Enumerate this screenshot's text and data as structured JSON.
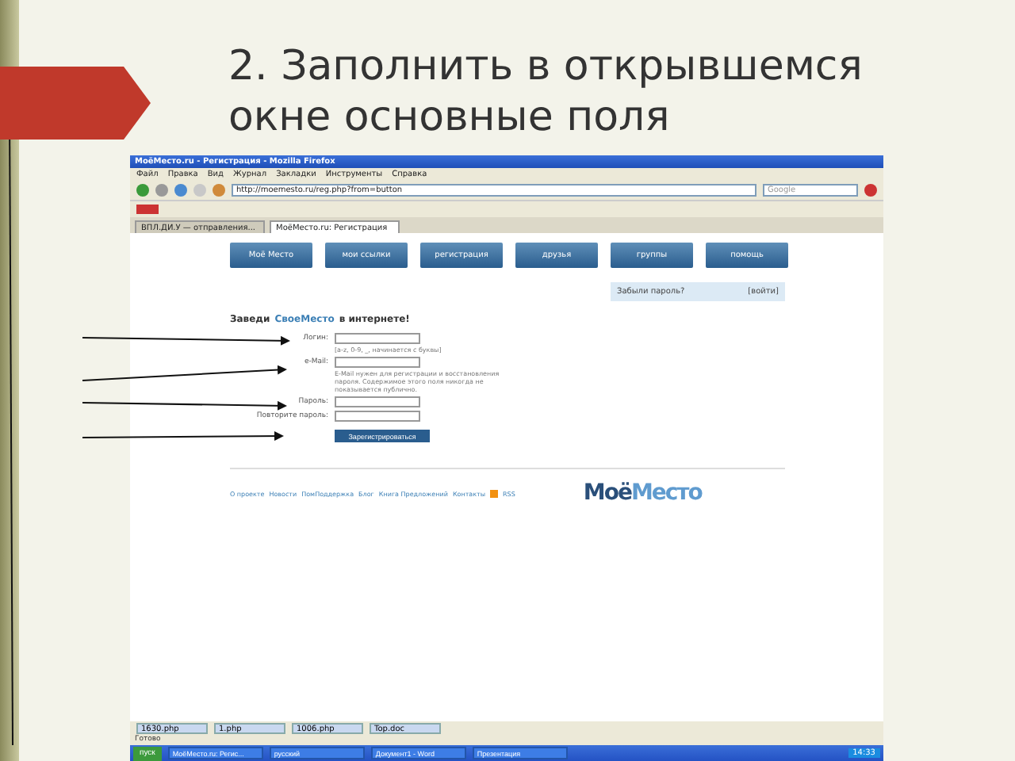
{
  "slide": {
    "title": "2. Заполнить в открывшемся окне основные поля"
  },
  "browser": {
    "title": "МоёМесто.ru - Регистрация - Mozilla Firefox",
    "menu": [
      "Файл",
      "Правка",
      "Вид",
      "Журнал",
      "Закладки",
      "Инструменты",
      "Справка"
    ],
    "address": "http://moemesto.ru/reg.php?from=button",
    "search_placeholder": "Google",
    "tabs": [
      {
        "label": "ВПЛ.ДИ.У — отправления...",
        "selected": false
      },
      {
        "label": "МоёМесто.ru: Регистрация",
        "selected": true
      }
    ]
  },
  "site": {
    "nav": [
      "Моё Место",
      "мои ссылки",
      "регистрация",
      "друзья",
      "группы",
      "помощь"
    ],
    "forgot": {
      "label": "Забыли пароль?",
      "link": "[войти]"
    },
    "heading": {
      "before": "Заведи",
      "brand": "СвоеМесто",
      "after": "в интернете!"
    },
    "fields": [
      {
        "label": "Логин:",
        "hint": "[a-z, 0-9, _, начинается с буквы]"
      },
      {
        "label": "e-Mail:",
        "hint": "E-Mail нужен для регистрации и восстановления пароля. Содержимое этого поля никогда не показывается публично."
      },
      {
        "label": "Пароль:"
      },
      {
        "label": "Повторите пароль:"
      }
    ],
    "submit": "Зарегистрироваться",
    "footer": [
      "О проекте",
      "Новости",
      "ПомПоддержка",
      "Блог",
      "Книга Предложений",
      "Контакты"
    ],
    "rss": "RSS",
    "logo": {
      "first": "Моё",
      "second": "Место"
    }
  },
  "downloads": [
    "1630.php",
    "1.php",
    "1006.php",
    "Top.doc"
  ],
  "status": "Готово",
  "taskbar": {
    "start": "пуск",
    "items": [
      "МоёМесто.ru: Регис...",
      "русский",
      "Документ1 - Word",
      "Презентация"
    ],
    "clock": "14:33"
  }
}
